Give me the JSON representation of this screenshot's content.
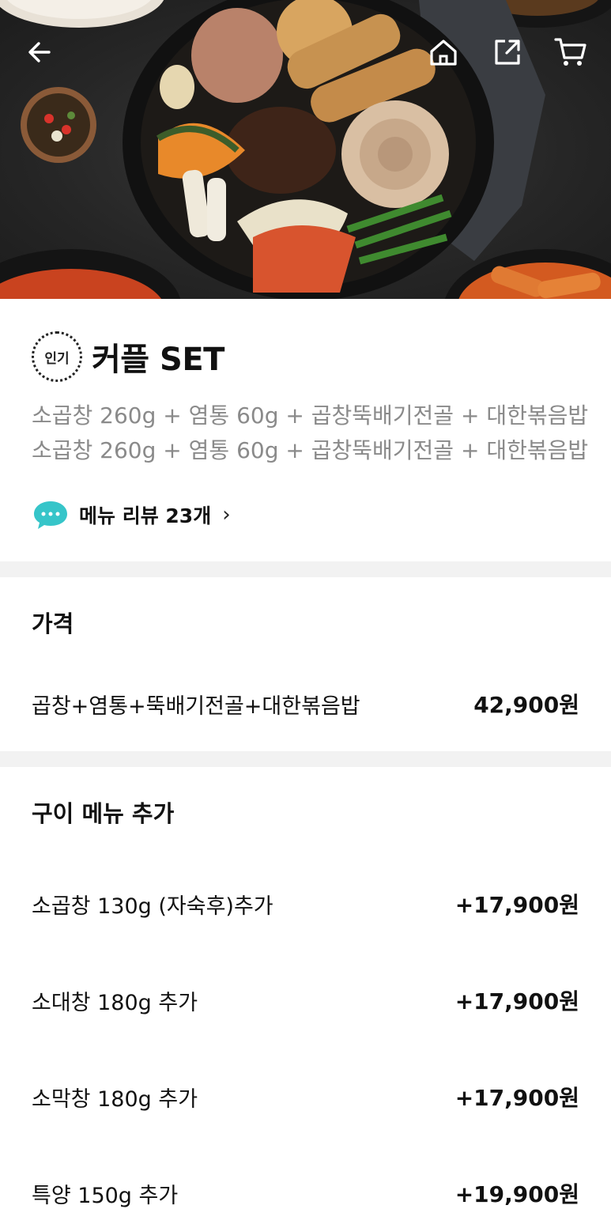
{
  "header": {
    "back_icon": "arrow-left-icon",
    "home_icon": "home-icon",
    "share_icon": "share-icon",
    "cart_icon": "cart-icon"
  },
  "product": {
    "badge": "인기",
    "title": "커플 SET",
    "description_lines": [
      "소곱창 260g + 염통 60g + 곱창뚝배기전골 + 대한볶음밥",
      "소곱창 260g + 염통 60g + 곱창뚝배기전골 + 대한볶음밥"
    ],
    "review_label": "메뉴 리뷰 23개",
    "review_chevron": "›"
  },
  "price_section": {
    "title": "가격",
    "item_label": "곱창+염통+뚝배기전골+대한볶음밥",
    "item_price": "42,900원"
  },
  "add_section": {
    "title": "구이 메뉴 추가",
    "items": [
      {
        "label": "소곱창 130g (자숙후)추가",
        "price": "+17,900원"
      },
      {
        "label": "소대창 180g 추가",
        "price": "+17,900원"
      },
      {
        "label": "소막창 180g 추가",
        "price": "+17,900원"
      },
      {
        "label": "특양 150g 추가",
        "price": "+19,900원"
      }
    ]
  },
  "colors": {
    "accent_bubble": "#36c5c9",
    "muted_text": "#8a8a8a",
    "divider": "#f2f2f2"
  }
}
